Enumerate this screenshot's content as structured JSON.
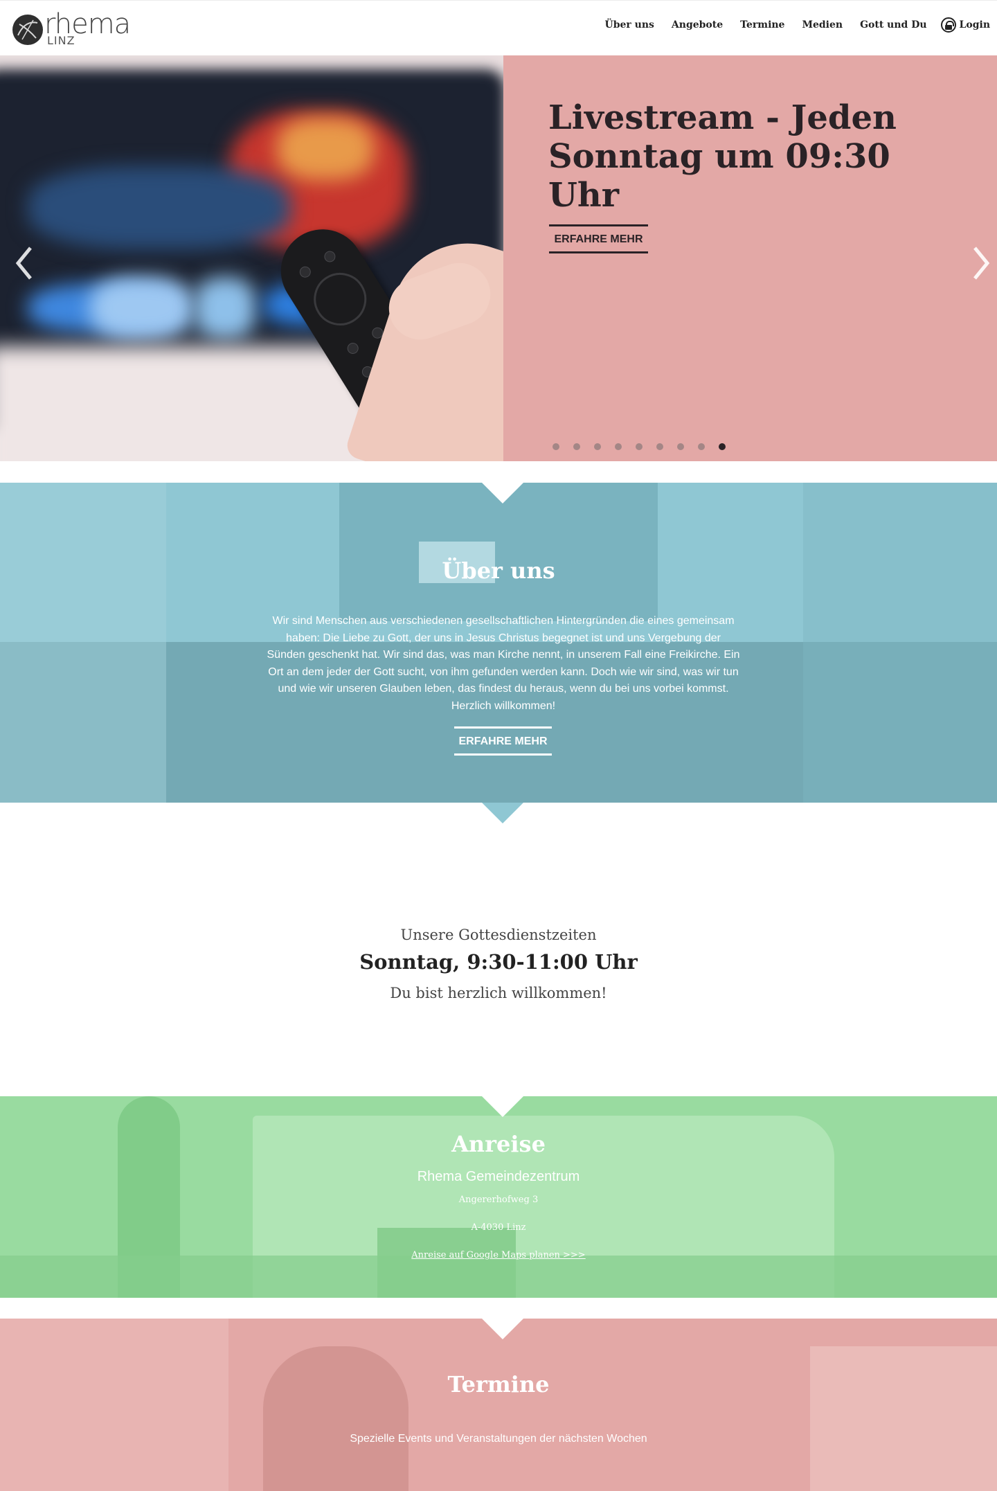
{
  "header": {
    "logo": {
      "word": "rhema",
      "sub": "LINZ"
    },
    "nav": [
      "Über uns",
      "Angebote",
      "Termine",
      "Medien",
      "Gott und Du"
    ],
    "login_label": "Login"
  },
  "slider": {
    "title": "Livestream - Jeden Sonntag um 09:30 Uhr",
    "button_label": "ERFAHRE MEHR",
    "slide_count": 9,
    "active_slide": 9,
    "colors": {
      "panel": "#e3a8a6",
      "text": "#2a2226"
    }
  },
  "about": {
    "title": "Über uns",
    "text": "Wir sind Menschen aus verschiedenen gesellschaftlichen Hintergründen die eines gemeinsam haben: Die Liebe zu Gott, der uns in Jesus Christus begegnet ist und uns Vergebung der Sünden geschenkt hat. Wir sind das, was man Kirche nennt, in unserem Fall eine Freikirche. Ein Ort an dem jeder der Gott sucht, von ihm gefunden werden kann. Doch wie wir sind, was wir tun und wie wir unseren Glauben leben, das findest du heraus, wenn du bei uns vorbei kommst. Herzlich willkommen!",
    "button_label": "ERFAHRE MEHR",
    "color": "#8fc7d3"
  },
  "times": {
    "label": "Unsere Gottesdienstzeiten",
    "value": "Sonntag, 9:30-11:00 Uhr",
    "welcome": "Du bist herzlich willkommen!"
  },
  "travel": {
    "title": "Anreise",
    "place": "Rhema Gemeindezentrum",
    "street": "Angererhofweg 3",
    "city": "A-4030 Linz",
    "link": "Anreise auf Google Maps planen >>>",
    "color": "#99dba0"
  },
  "events": {
    "title": "Termine",
    "subtitle": "Spezielle Events und Veranstaltungen der nächsten Wochen",
    "color": "#e3a8a6"
  }
}
